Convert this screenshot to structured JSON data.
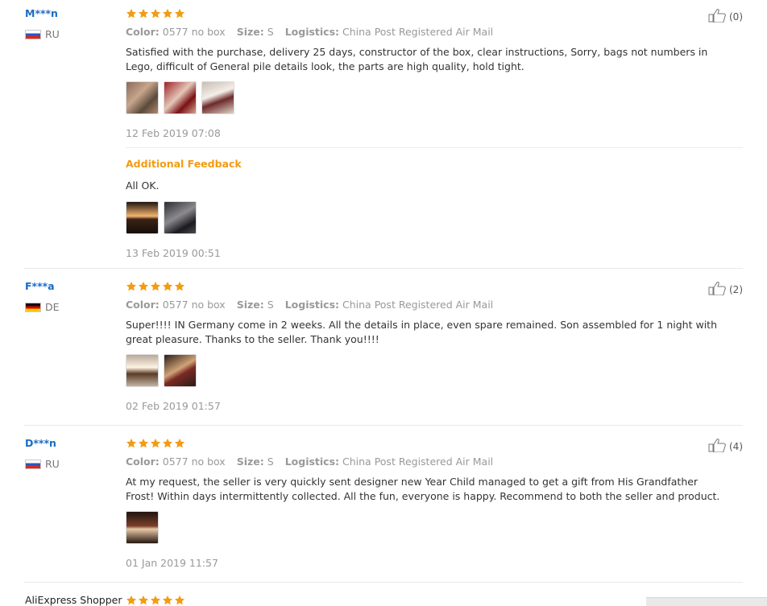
{
  "reviews": [
    {
      "user": "M***n",
      "country": "RU",
      "flag": "russia-flag",
      "rating": 5,
      "attributes": {
        "color_label": "Color:",
        "color_value": "0577 no box",
        "size_label": "Size:",
        "size_value": "S",
        "logistics_label": "Logistics:",
        "logistics_value": "China Post Registered Air Mail"
      },
      "text": "Satisfied with the purchase, delivery 25 days, constructor of the box, clear instructions, Sorry, bags not numbers in Lego, difficult of General pile details look, the parts are high quality, hold tight.",
      "photo_count": 3,
      "date": "12 Feb 2019 07:08",
      "helpful": "(0)",
      "additional": {
        "title": "Additional Feedback",
        "text": "All OK.",
        "photo_count": 2,
        "date": "13 Feb 2019 00:51"
      }
    },
    {
      "user": "F***a",
      "country": "DE",
      "flag": "germany-flag",
      "rating": 5,
      "attributes": {
        "color_label": "Color:",
        "color_value": "0577 no box",
        "size_label": "Size:",
        "size_value": "S",
        "logistics_label": "Logistics:",
        "logistics_value": "China Post Registered Air Mail"
      },
      "text": "Super!!!! IN Germany come in 2 weeks. All the details in place, even spare remained. Son assembled for 1 night with great pleasure. Thanks to the seller. Thank you!!!!",
      "photo_count": 2,
      "date": "02 Feb 2019 01:57",
      "helpful": "(2)"
    },
    {
      "user": "D***n",
      "country": "RU",
      "flag": "russia-flag",
      "rating": 5,
      "attributes": {
        "color_label": "Color:",
        "color_value": "0577 no box",
        "size_label": "Size:",
        "size_value": "S",
        "logistics_label": "Logistics:",
        "logistics_value": "China Post Registered Air Mail"
      },
      "text": "At my request, the seller is very quickly sent designer new Year Child managed to get a gift from His Grandfather Frost! Within days intermittently collected. All the fun, everyone is happy. Recommend to both the seller and product.",
      "photo_count": 1,
      "date": "01 Jan 2019 11:57",
      "helpful": "(4)"
    },
    {
      "user": "AliExpress Shopper",
      "rating": 5
    }
  ],
  "colors": {
    "star": "#f39c12",
    "username": "#1a6bc6",
    "additional_title": "#f39c12"
  },
  "icons": {
    "rating": "star-icon",
    "helpful": "thumbs-up-icon"
  }
}
